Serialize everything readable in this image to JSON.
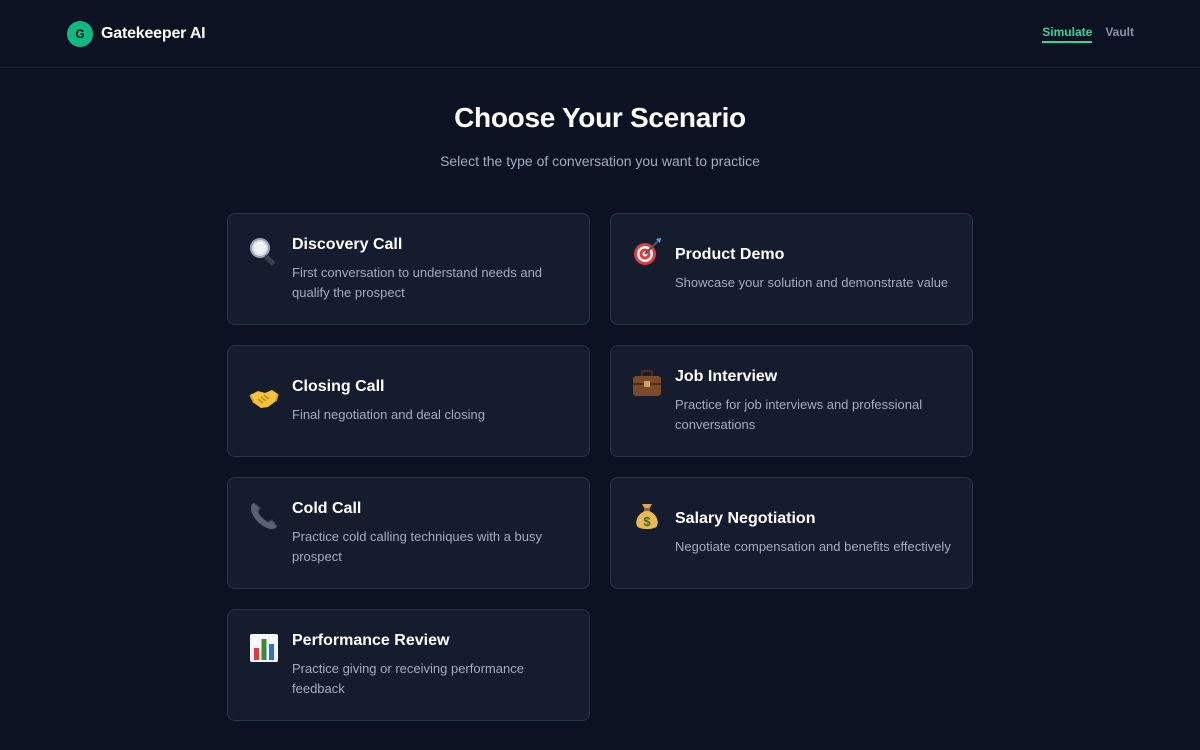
{
  "header": {
    "logo_letter": "G",
    "brand": "Gatekeeper AI",
    "nav": [
      {
        "label": "Simulate",
        "active": true
      },
      {
        "label": "Vault",
        "active": false
      }
    ]
  },
  "main": {
    "title": "Choose Your Scenario",
    "subtitle": "Select the type of conversation you want to practice"
  },
  "scenarios": [
    {
      "icon": "magnifying-glass-icon",
      "title": "Discovery Call",
      "description": "First conversation to understand needs and qualify the prospect"
    },
    {
      "icon": "dart-target-icon",
      "title": "Product Demo",
      "description": "Showcase your solution and demonstrate value"
    },
    {
      "icon": "handshake-icon",
      "title": "Closing Call",
      "description": "Final negotiation and deal closing"
    },
    {
      "icon": "briefcase-icon",
      "title": "Job Interview",
      "description": "Practice for job interviews and professional conversations"
    },
    {
      "icon": "telephone-receiver-icon",
      "title": "Cold Call",
      "description": "Practice cold calling techniques with a busy prospect"
    },
    {
      "icon": "money-bag-icon",
      "title": "Salary Negotiation",
      "description": "Negotiate compensation and benefits effectively"
    },
    {
      "icon": "bar-chart-icon",
      "title": "Performance Review",
      "description": "Practice giving or receiving performance feedback"
    }
  ],
  "colors": {
    "background": "#0c1222",
    "card": "#141c2e",
    "accent": "#34d399"
  }
}
